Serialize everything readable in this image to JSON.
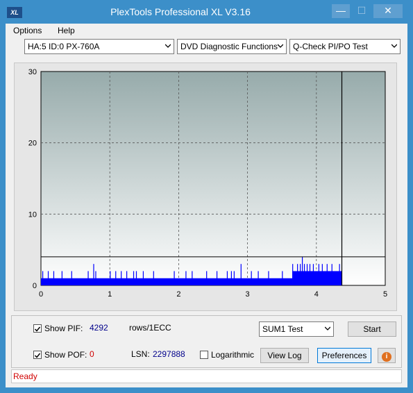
{
  "window": {
    "title": "PlexTools Professional XL V3.16",
    "icon_label": "XL",
    "minimize_label": "—",
    "maximize_label": "☐",
    "close_label": "✕"
  },
  "menu": {
    "options": "Options",
    "help": "Help"
  },
  "toolbar": {
    "drive": "HA:5 ID:0  PX-760A",
    "function": "DVD Diagnostic Functions",
    "test": "Q-Check PI/PO Test"
  },
  "chart_data": {
    "type": "bar",
    "xlim": [
      0,
      5
    ],
    "ylim": [
      0,
      30
    ],
    "xticks": [
      "0",
      "1",
      "2",
      "3",
      "4",
      "5"
    ],
    "yticks": [
      "0",
      "10",
      "20",
      "30"
    ],
    "grid": true,
    "series": [
      {
        "color": "#0000ff",
        "segments": [
          {
            "x0": 0.0,
            "x1": 3.65,
            "base": 1
          },
          {
            "x0": 3.65,
            "x1": 3.8,
            "base": 2
          },
          {
            "x0": 3.8,
            "x1": 4.37,
            "base": 2
          }
        ],
        "spikes": [
          {
            "x": 0.02,
            "y": 2
          },
          {
            "x": 0.1,
            "y": 2
          },
          {
            "x": 0.18,
            "y": 2
          },
          {
            "x": 0.3,
            "y": 2
          },
          {
            "x": 0.44,
            "y": 2
          },
          {
            "x": 0.68,
            "y": 2
          },
          {
            "x": 0.76,
            "y": 3
          },
          {
            "x": 0.79,
            "y": 2
          },
          {
            "x": 1.0,
            "y": 2
          },
          {
            "x": 1.08,
            "y": 2
          },
          {
            "x": 1.16,
            "y": 2
          },
          {
            "x": 1.24,
            "y": 2
          },
          {
            "x": 1.34,
            "y": 2
          },
          {
            "x": 1.38,
            "y": 2
          },
          {
            "x": 1.48,
            "y": 2
          },
          {
            "x": 1.63,
            "y": 2
          },
          {
            "x": 1.93,
            "y": 2
          },
          {
            "x": 2.1,
            "y": 2
          },
          {
            "x": 2.19,
            "y": 2
          },
          {
            "x": 2.4,
            "y": 2
          },
          {
            "x": 2.55,
            "y": 2
          },
          {
            "x": 2.7,
            "y": 2
          },
          {
            "x": 2.76,
            "y": 2
          },
          {
            "x": 2.8,
            "y": 2
          },
          {
            "x": 2.9,
            "y": 3
          },
          {
            "x": 3.05,
            "y": 2
          },
          {
            "x": 3.15,
            "y": 2
          },
          {
            "x": 3.3,
            "y": 2
          },
          {
            "x": 3.5,
            "y": 2
          },
          {
            "x": 3.65,
            "y": 3
          },
          {
            "x": 3.72,
            "y": 3
          },
          {
            "x": 3.76,
            "y": 3
          },
          {
            "x": 3.79,
            "y": 4
          },
          {
            "x": 3.82,
            "y": 3
          },
          {
            "x": 3.86,
            "y": 3
          },
          {
            "x": 3.9,
            "y": 3
          },
          {
            "x": 3.95,
            "y": 3
          },
          {
            "x": 4.03,
            "y": 3
          },
          {
            "x": 4.08,
            "y": 3
          },
          {
            "x": 4.15,
            "y": 3
          },
          {
            "x": 4.22,
            "y": 3
          },
          {
            "x": 4.33,
            "y": 3
          }
        ]
      }
    ],
    "threshold_y": 4,
    "marker_x": 4.37
  },
  "controls": {
    "show_pif_label": "Show PIF:",
    "pif_value": "4292",
    "pif_unit": "rows/1ECC",
    "show_pof_label": "Show POF:",
    "pof_value": "0",
    "lsn_label": "LSN:",
    "lsn_value": "2297888",
    "logarithmic_label": "Logarithmic",
    "sum_test": "SUM1 Test",
    "start_label": "Start",
    "viewlog_label": "View Log",
    "preferences_label": "Preferences",
    "info_icon": "i"
  },
  "status": {
    "text": "Ready"
  }
}
